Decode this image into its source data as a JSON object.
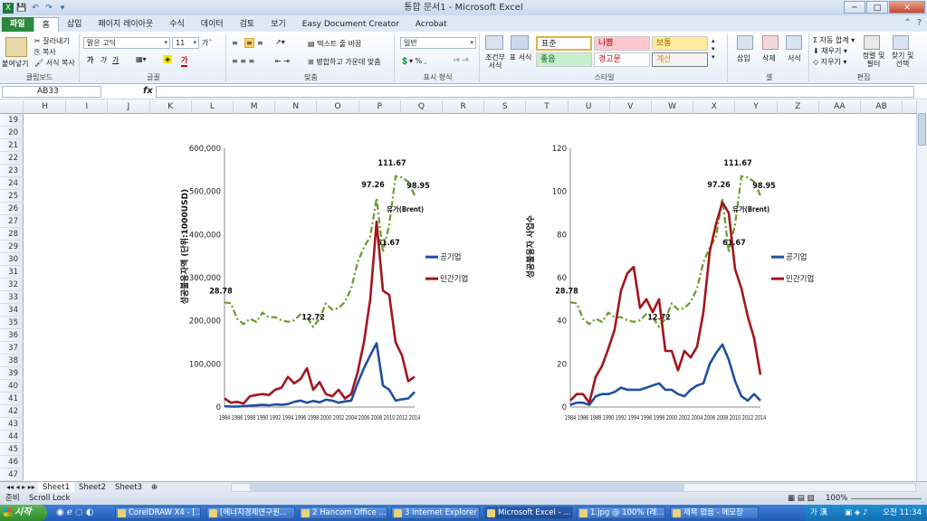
{
  "window": {
    "title": "통합 문서1 - Microsoft Excel",
    "controls": [
      "─",
      "□",
      "✕"
    ]
  },
  "qat": [
    "💾",
    "↶",
    "↷",
    "▾"
  ],
  "tabs": [
    "파일",
    "홈",
    "삽입",
    "페이지 레이아웃",
    "수식",
    "데이터",
    "검토",
    "보기",
    "Easy Document Creator",
    "Acrobat"
  ],
  "ribbon": {
    "clipboard": {
      "paste": "붙여넣기",
      "cut": "잘라내기",
      "copy": "복사",
      "format_painter": "서식 복사",
      "label": "클립보드"
    },
    "font": {
      "name": "맑은 고딕",
      "size": "11",
      "label": "글꼴",
      "bold": "가",
      "italic": "가",
      "underline": "가"
    },
    "alignment": {
      "wrap": "텍스트 줄 바꿈",
      "merge": "병합하고 가운데 맞춤",
      "label": "맞춤"
    },
    "number": {
      "format": "일반",
      "label": "표시 형식"
    },
    "styles": {
      "conditional": "조건부 서식",
      "table": "표 서식",
      "cells": [
        "표준",
        "나쁨",
        "보통",
        "좋음",
        "경고문",
        "계산"
      ],
      "label": "스타일"
    },
    "cells_group": {
      "insert": "삽입",
      "delete": "삭제",
      "format": "서식",
      "label": "셀"
    },
    "editing": {
      "autosum": "자동 합계",
      "fill": "채우기",
      "clear": "지우기",
      "sort": "정렬 및 필터",
      "find": "찾기 및 선택",
      "label": "편집"
    }
  },
  "formula_bar": {
    "name_box": "AB33",
    "fx": "fx",
    "value": ""
  },
  "columns": [
    "H",
    "I",
    "J",
    "K",
    "L",
    "M",
    "N",
    "O",
    "P",
    "Q",
    "R",
    "S",
    "T",
    "U",
    "V",
    "W",
    "X",
    "Y",
    "Z",
    "AA",
    "AB"
  ],
  "rows": [
    "19",
    "20",
    "21",
    "22",
    "23",
    "24",
    "25",
    "26",
    "27",
    "28",
    "29",
    "30",
    "31",
    "32",
    "33",
    "34",
    "35",
    "36",
    "37",
    "38",
    "39",
    "40",
    "41",
    "42",
    "43",
    "44",
    "45",
    "46",
    "47"
  ],
  "chart_data": [
    {
      "type": "line",
      "ylabel": "성공불융자액 (단위:1000USD)",
      "ylim": [
        0,
        600000
      ],
      "yticks": [
        "0",
        "100,000",
        "200,000",
        "300,000",
        "400,000",
        "500,000",
        "600,000"
      ],
      "xticks": [
        "1984",
        "1986",
        "1988",
        "1990",
        "1992",
        "1994",
        "1996",
        "1998",
        "2000",
        "2002",
        "2004",
        "2006",
        "2008",
        "2010",
        "2012",
        "2014"
      ],
      "x": [
        1984,
        1985,
        1986,
        1987,
        1988,
        1989,
        1990,
        1991,
        1992,
        1993,
        1994,
        1995,
        1996,
        1997,
        1998,
        1999,
        2000,
        2001,
        2002,
        2003,
        2004,
        2005,
        2006,
        2007,
        2008,
        2009,
        2010,
        2011,
        2012,
        2013,
        2014
      ],
      "series": [
        {
          "name": "공기업",
          "color": "#1f4fa0",
          "values": [
            2000,
            1000,
            1000,
            2000,
            3000,
            4000,
            5000,
            4000,
            6000,
            5000,
            7000,
            12000,
            15000,
            10000,
            14000,
            11000,
            17000,
            15000,
            10000,
            13000,
            15000,
            55000,
            90000,
            120000,
            148000,
            50000,
            40000,
            15000,
            18000,
            20000,
            35000
          ]
        },
        {
          "name": "민간기업",
          "color": "#a3151c",
          "values": [
            20000,
            10000,
            12000,
            8000,
            25000,
            28000,
            30000,
            28000,
            40000,
            45000,
            70000,
            55000,
            65000,
            90000,
            40000,
            58000,
            30000,
            25000,
            40000,
            20000,
            30000,
            80000,
            150000,
            250000,
            430000,
            270000,
            260000,
            150000,
            120000,
            60000,
            70000
          ]
        }
      ],
      "oil": {
        "name": "유가(Brent)",
        "color": "#6a9a2a",
        "values": [
          28.78,
          28.2,
          18,
          14.5,
          18,
          16,
          22,
          19,
          19,
          17,
          16,
          17,
          21,
          19,
          12.72,
          18,
          28,
          24,
          25,
          29,
          38,
          55,
          65,
          72,
          97.26,
          61.67,
          80,
          111.67,
          111,
          108,
          98.95
        ]
      },
      "oil_labels": [
        "28.78",
        "12.72",
        "97.26",
        "61.67",
        "111.67",
        "98.95"
      ]
    },
    {
      "type": "line",
      "ylabel": "성공불융자 사업수",
      "ylim": [
        0,
        120
      ],
      "yticks": [
        "0",
        "20",
        "40",
        "60",
        "80",
        "100",
        "120"
      ],
      "xticks": [
        "1984",
        "1986",
        "1988",
        "1990",
        "1992",
        "1994",
        "1996",
        "1998",
        "2000",
        "2002",
        "2004",
        "2006",
        "2008",
        "2010",
        "2012",
        "2014"
      ],
      "x": [
        1984,
        1985,
        1986,
        1987,
        1988,
        1989,
        1990,
        1991,
        1992,
        1993,
        1994,
        1995,
        1996,
        1997,
        1998,
        1999,
        2000,
        2001,
        2002,
        2003,
        2004,
        2005,
        2006,
        2007,
        2008,
        2009,
        2010,
        2011,
        2012,
        2013,
        2014
      ],
      "series": [
        {
          "name": "공기업",
          "color": "#1f4fa0",
          "values": [
            1,
            2,
            2,
            1,
            5,
            6,
            6,
            7,
            9,
            8,
            8,
            8,
            9,
            10,
            11,
            8,
            8,
            6,
            5,
            8,
            10,
            11,
            20,
            25,
            29,
            22,
            12,
            5,
            3,
            6,
            3
          ]
        },
        {
          "name": "민간기업",
          "color": "#a3151c",
          "values": [
            3,
            6,
            6,
            2,
            14,
            19,
            27,
            36,
            54,
            62,
            65,
            46,
            50,
            44,
            50,
            26,
            26,
            17,
            26,
            23,
            28,
            44,
            72,
            85,
            95,
            90,
            64,
            55,
            42,
            32,
            15
          ]
        }
      ],
      "oil": {
        "name": "유가(Brent)",
        "color": "#6a9a2a",
        "values": [
          28.78,
          28.2,
          18,
          14.5,
          18,
          16,
          22,
          19,
          19,
          17,
          16,
          17,
          21,
          19,
          12.72,
          18,
          28,
          24,
          25,
          29,
          38,
          55,
          65,
          72,
          97.26,
          61.67,
          80,
          111.67,
          111,
          108,
          98.95
        ]
      },
      "oil_labels": [
        "28.78",
        "12.72",
        "97.26",
        "61.67",
        "111.67",
        "98.95"
      ]
    }
  ],
  "sheets": [
    "Sheet1",
    "Sheet2",
    "Sheet3"
  ],
  "status": {
    "ready": "준비",
    "scroll_lock": "Scroll Lock",
    "zoom": "100%"
  },
  "taskbar": {
    "start": "시작",
    "items": [
      "CorelDRAW X4 - [...",
      "[에너지경제연구원...",
      "2 Hancom Office ...",
      "3 Internet Explorer",
      "Microsoft Excel - ...",
      "1.jpg @ 100% (레...",
      "제목 없음 - 메모장"
    ],
    "tray_text": "가 漢",
    "clock": "오전 11:34"
  }
}
